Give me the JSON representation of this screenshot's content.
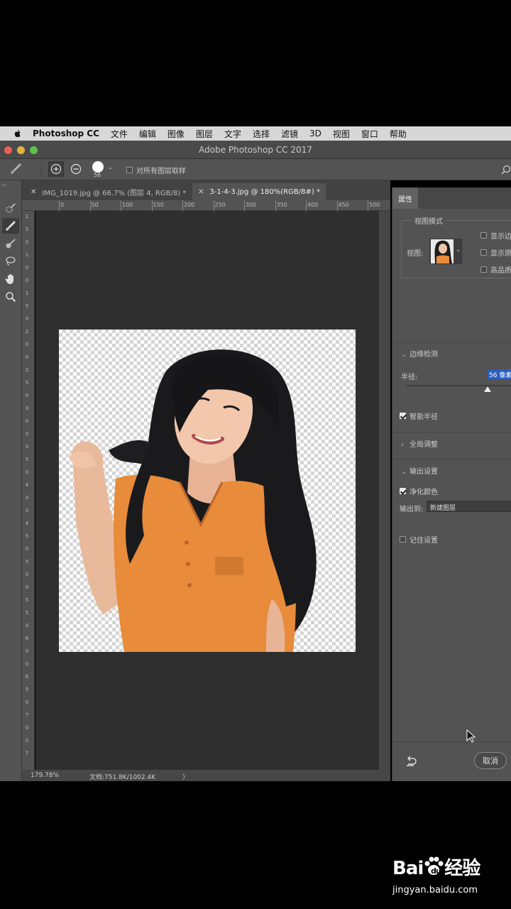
{
  "menubar": {
    "app": "Photoshop CC",
    "items": [
      "文件",
      "编辑",
      "图像",
      "图层",
      "文字",
      "选择",
      "滤镜",
      "3D",
      "视图",
      "窗口",
      "帮助"
    ]
  },
  "window": {
    "title": "Adobe Photoshop CC 2017"
  },
  "options": {
    "brush_size": "56",
    "sample_all_layers": "对所有图层取样"
  },
  "tabs": [
    {
      "label": "IMG_1019.jpg @ 66.7% (图层 4, RGB/8) *",
      "active": false
    },
    {
      "label": "3-1-4-3.jpg @ 180%(RGB/8#) *",
      "active": true
    }
  ],
  "ruler": {
    "top": [
      "0",
      "50",
      "100",
      "150",
      "200",
      "250",
      "300",
      "350",
      "400",
      "450",
      "500"
    ],
    "left": [
      "1",
      "5",
      "0",
      "1",
      "0",
      "0",
      "1",
      "5",
      "0",
      "2",
      "0",
      "0",
      "2",
      "5",
      "0",
      "3",
      "0",
      "0",
      "3",
      "5",
      "0",
      "4",
      "0",
      "0",
      "4",
      "5",
      "0",
      "5",
      "0",
      "0",
      "5",
      "5",
      "0",
      "6",
      "0",
      "0",
      "6",
      "5",
      "0",
      "7",
      "0",
      "0",
      "7"
    ]
  },
  "status": {
    "zoom": "179.78%",
    "doc": "文档:751.8K/1002.4K",
    "arrow": "〉"
  },
  "properties": {
    "tab": "属性",
    "view_mode": {
      "legend": "视图模式",
      "view_label": "视图:",
      "options": [
        "显示边缘",
        "显示原稿",
        "高品质预览"
      ]
    },
    "edge_detection": {
      "title": "边缘检测",
      "radius_label": "半径:",
      "radius_value": "56 像素",
      "smart_radius": "智能半径",
      "radius_fraction": 0.76
    },
    "global_refine": {
      "title": "全局调整"
    },
    "output": {
      "title": "输出设置",
      "decontaminate": "净化颜色",
      "output_to_label": "输出到:",
      "output_to": "新建图层"
    },
    "remember": "记住设置",
    "cancel": "取消"
  },
  "watermark": {
    "logo": "Bai",
    "logo2": "经验",
    "url": "jingyan.baidu.com"
  },
  "colors": {
    "accent_blue": "#2a5fbf",
    "panel": "#535353",
    "canvas": "#2f2f2f"
  }
}
